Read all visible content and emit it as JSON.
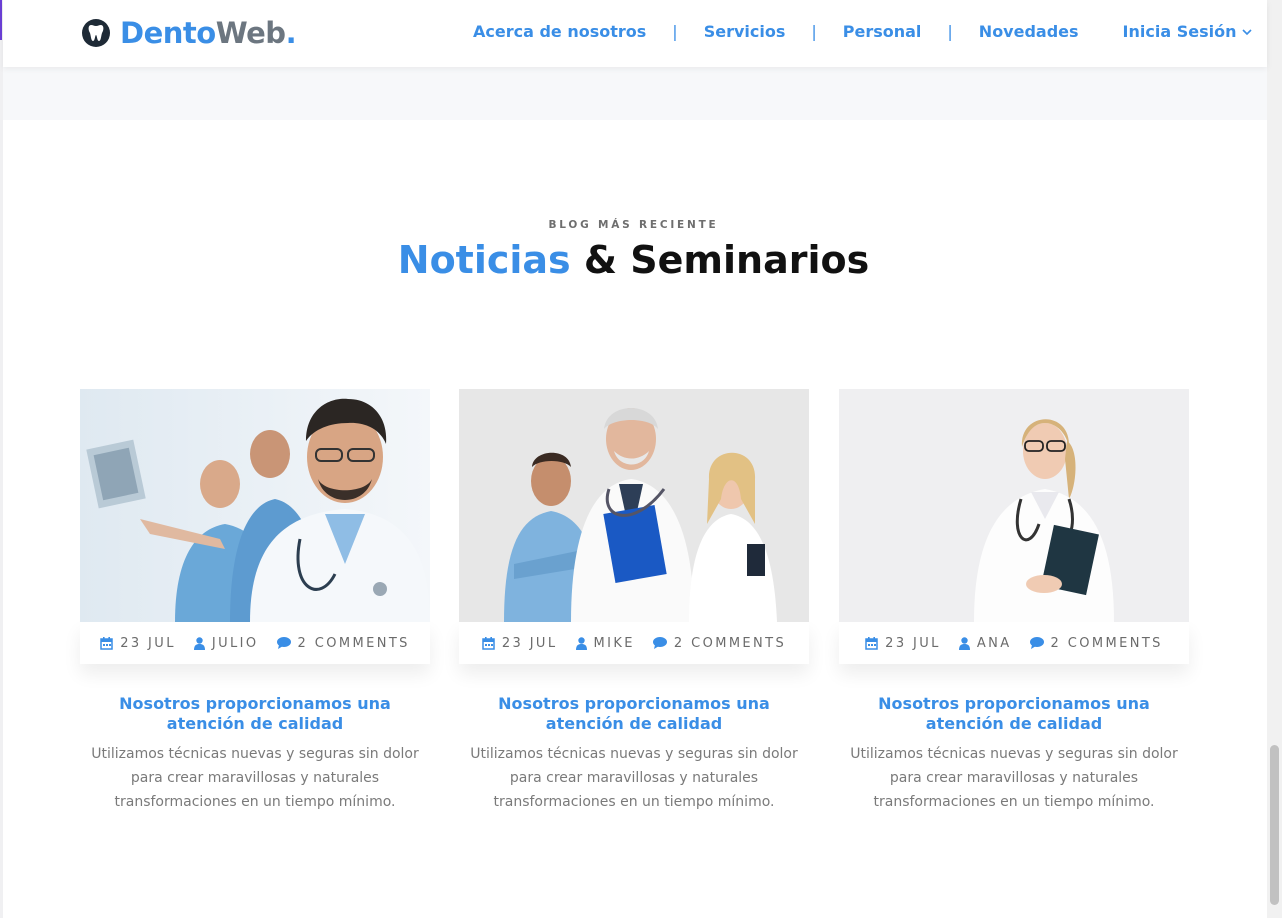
{
  "brand": {
    "name_part1": "Dento",
    "name_part2": "Web",
    "name_part3": ".",
    "icon": "tooth-icon"
  },
  "nav": {
    "items": [
      "Acerca de nosotros",
      "Servicios",
      "Personal",
      "Novedades"
    ],
    "separator": "|",
    "login_label": "Inicia Sesión",
    "login_icon": "chevron-down-icon"
  },
  "section": {
    "kicker": "BLOG MÁS RECIENTE",
    "title_highlight": "Noticias",
    "title_rest": " & Seminarios"
  },
  "colors": {
    "accent": "#3a8ee6",
    "dark": "#111111",
    "muted": "#7a7a7a"
  },
  "posts": [
    {
      "date": "23 JUL",
      "author": "JULIO",
      "comments": "2 COMMENTS",
      "title": "Nosotros proporcionamos una atención de calidad",
      "excerpt": "Utilizamos técnicas nuevas y seguras sin dolor para crear maravillosas y naturales transformaciones en un tiempo mínimo.",
      "image": "smiling-doctor-photo"
    },
    {
      "date": "23 JUL",
      "author": "MIKE",
      "comments": "2 COMMENTS",
      "title": "Nosotros proporcionamos una atención de calidad",
      "excerpt": "Utilizamos técnicas nuevas y seguras sin dolor para crear maravillosas y naturales transformaciones en un tiempo mínimo.",
      "image": "medical-team-photo"
    },
    {
      "date": "23 JUL",
      "author": "ANA",
      "comments": "2 COMMENTS",
      "title": "Nosotros proporcionamos una atención de calidad",
      "excerpt": "Utilizamos técnicas nuevas y seguras sin dolor para crear maravillosas y naturales transformaciones en un tiempo mínimo.",
      "image": "female-doctor-photo"
    }
  ]
}
